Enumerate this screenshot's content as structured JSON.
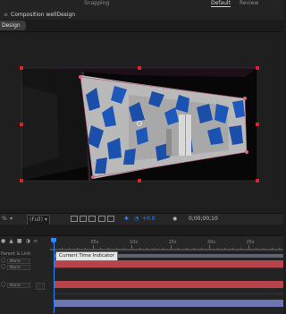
{
  "top_bar": {
    "snapping": "Snapping",
    "workspace_default": "Default",
    "workspace_review": "Review"
  },
  "comp_panel": {
    "title": "Composition wellDesign",
    "close_glyph": "≡",
    "sub_tab": "Design"
  },
  "viewer_toolbar": {
    "zoom": "%",
    "resolution": "(Full)",
    "exposure": "+0.0",
    "timecode": "0;00;00;10"
  },
  "timeline": {
    "ruler_labels": [
      "0s",
      "05s",
      "10s",
      "15s",
      "20s",
      "25s"
    ],
    "column_header": "Parent & Link",
    "parent_value": "None",
    "tooltip": "Current Time Indicator",
    "playhead_seconds": 0.33
  },
  "colors": {
    "accent_blue": "#2f86ff",
    "handle_red": "#e0202a",
    "bar_red": "#b8444b",
    "bar_blue": "#6d74b0"
  }
}
